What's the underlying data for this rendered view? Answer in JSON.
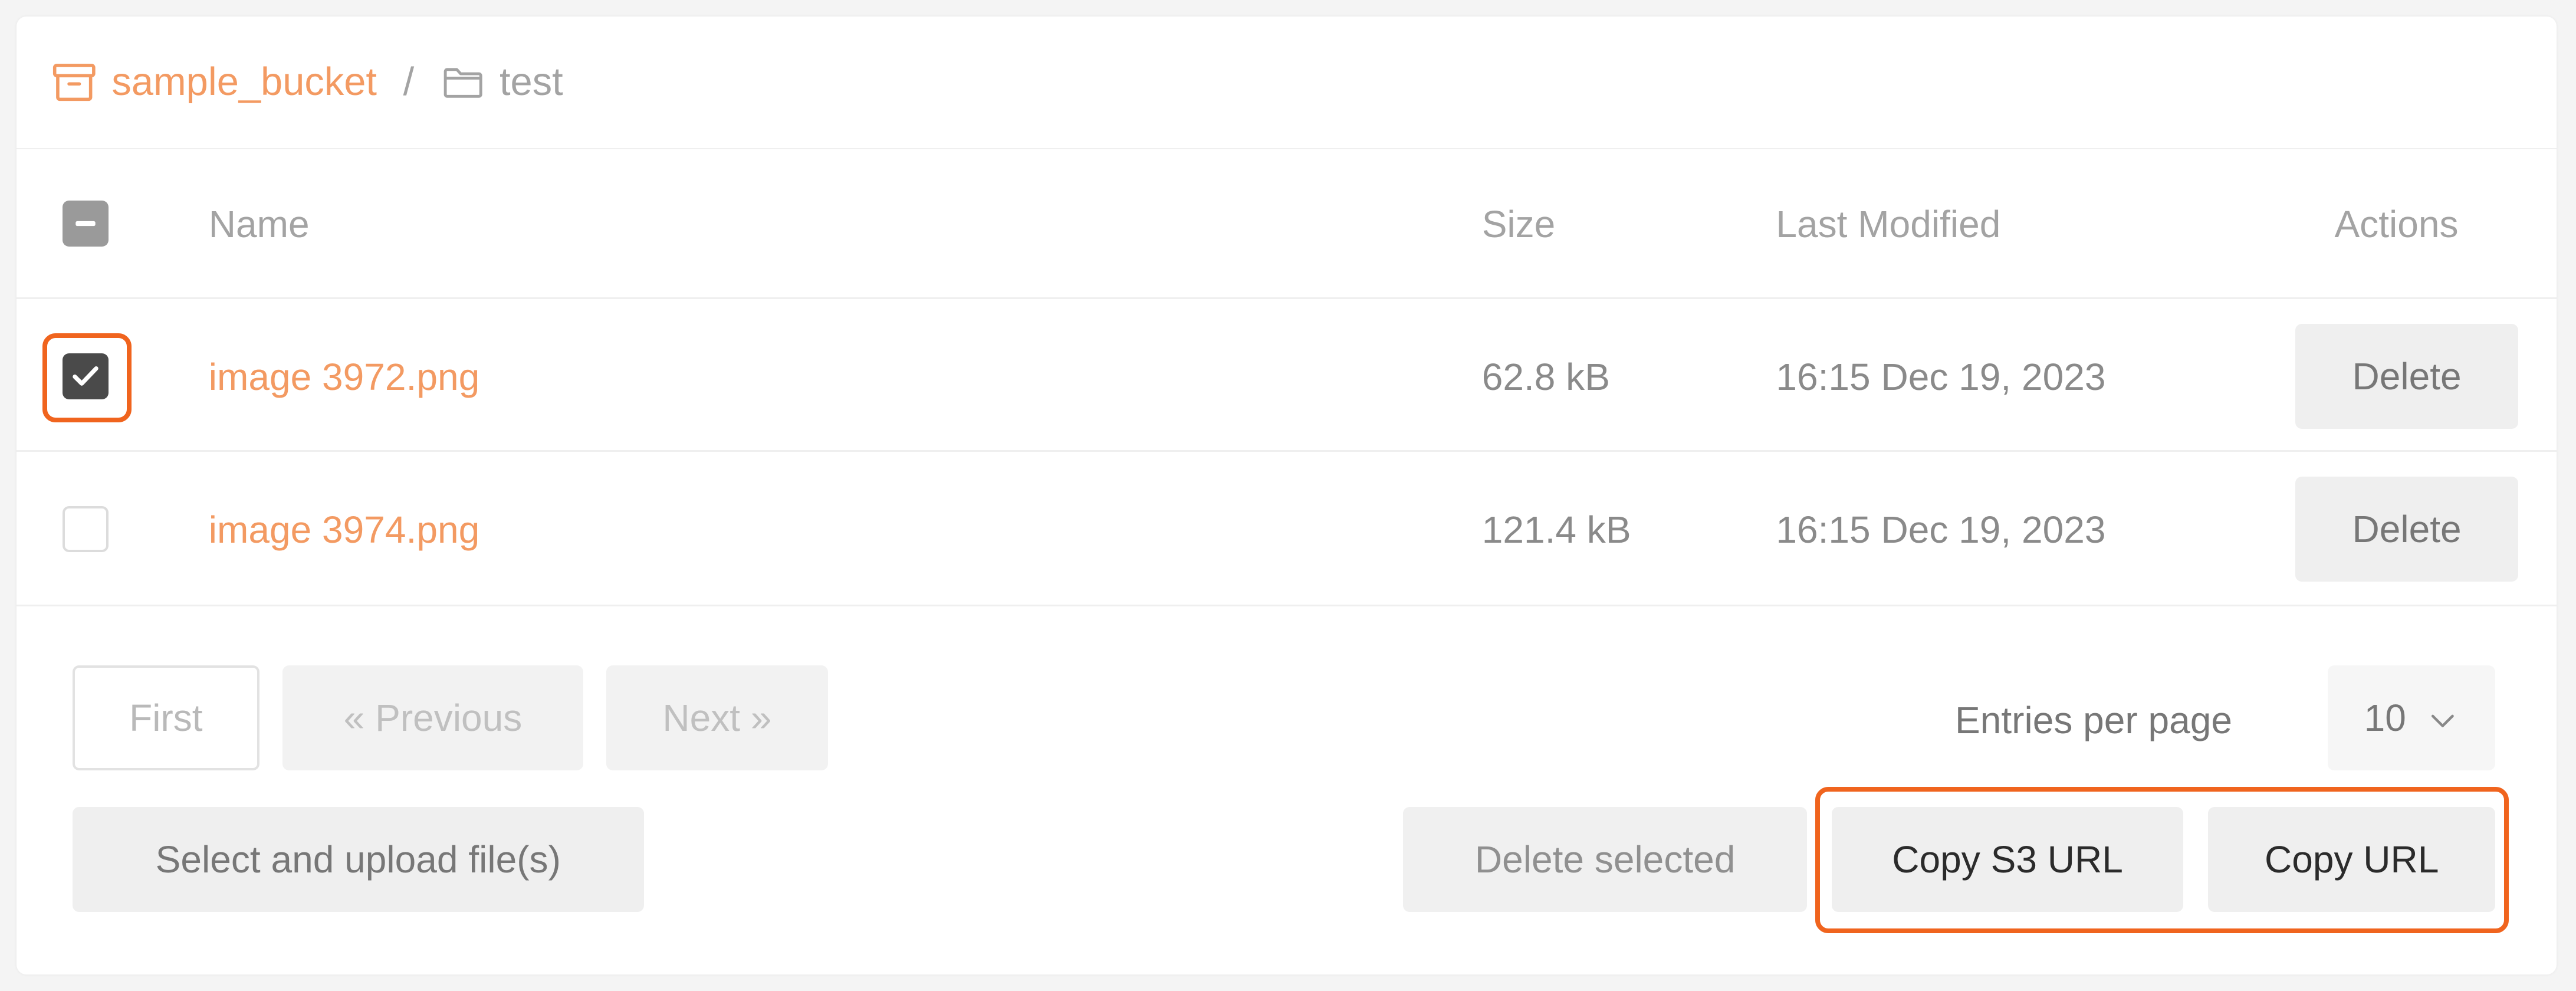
{
  "breadcrumb": {
    "bucket": "sample_bucket",
    "separator": "/",
    "folder": "test"
  },
  "table": {
    "columns": {
      "name": "Name",
      "size": "Size",
      "last_modified": "Last Modified",
      "actions": "Actions"
    },
    "header_checkbox": "indeterminate",
    "rows": [
      {
        "name": "image 3972.png",
        "size": "62.8 kB",
        "last_modified": "16:15 Dec 19, 2023",
        "action": "Delete",
        "checked": true
      },
      {
        "name": "image 3974.png",
        "size": "121.4 kB",
        "last_modified": "16:15 Dec 19, 2023",
        "action": "Delete",
        "checked": false
      }
    ]
  },
  "pagination": {
    "first": "First",
    "previous": "« Previous",
    "next": "Next »",
    "entries_label": "Entries per page",
    "entries_value": "10"
  },
  "actions": {
    "upload": "Select and upload file(s)",
    "delete_selected": "Delete selected",
    "copy_s3_url": "Copy S3 URL",
    "copy_url": "Copy URL"
  },
  "colors": {
    "accent": "#f39a62",
    "highlight": "#f0641e"
  },
  "icons": {
    "bucket": "archive-box-icon",
    "folder": "folder-icon",
    "check": "checkmark-icon",
    "dropdown": "chevron-down-icon"
  }
}
